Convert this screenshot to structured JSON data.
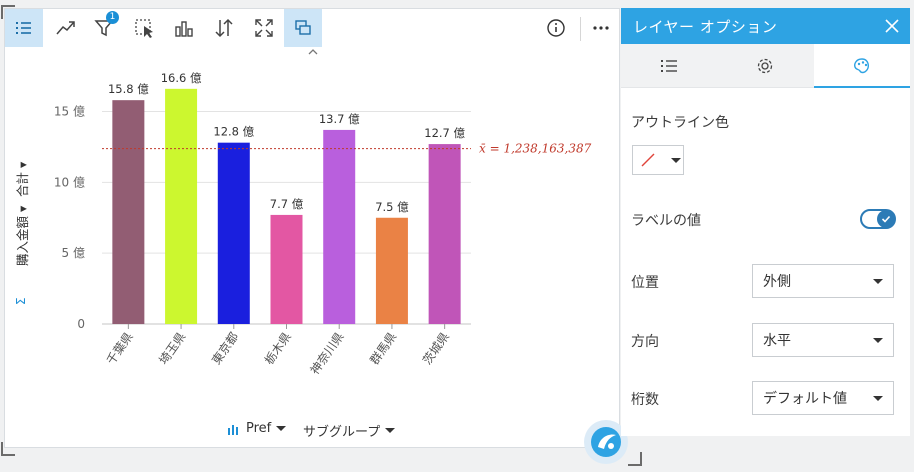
{
  "toolbar": {
    "buttons": [
      "legend",
      "trend",
      "filter",
      "select",
      "visualization-type",
      "sort",
      "maximize",
      "flip-card",
      "info",
      "more"
    ],
    "filter_badge": "1"
  },
  "colors": {
    "accent": "#2ea3e3",
    "mean_line": "#c0392b",
    "toggle_on": "#2c7bb6"
  },
  "chart": {
    "y_axis_title": "購入金額",
    "y_axis_stat": "合計",
    "mean_label": "x̄ = 1,238,163,387",
    "x_field": "Pref",
    "subgroup_label": "サブグループ"
  },
  "chart_data": {
    "type": "bar",
    "categories": [
      "千葉県",
      "埼玉県",
      "東京都",
      "栃木県",
      "神奈川県",
      "群馬県",
      "茨城県"
    ],
    "values": [
      1580000000,
      1660000000,
      1280000000,
      770000000,
      1370000000,
      750000000,
      1270000000
    ],
    "data_labels": [
      "15.8 億",
      "16.6 億",
      "12.8 億",
      "7.7 億",
      "13.7 億",
      "7.5 億",
      "12.7 億"
    ],
    "bar_colors": [
      "#925d73",
      "#ccf72f",
      "#1a1fde",
      "#e357a3",
      "#b95fdd",
      "#ea8245",
      "#c055b8"
    ],
    "ylabel": "購入金額 合計",
    "ylim": [
      0,
      1800000000
    ],
    "yticks": [
      0,
      500000000,
      1000000000,
      1500000000
    ],
    "ytick_labels": [
      "0",
      "5 億",
      "10 億",
      "15 億"
    ],
    "mean": 1238163387,
    "grid": true
  },
  "panel": {
    "title": "レイヤー オプション",
    "tabs": [
      "legend-tab",
      "settings-tab",
      "style-tab"
    ],
    "outline_color_label": "アウトライン色",
    "label_values_label": "ラベルの値",
    "label_values_on": true,
    "position_label": "位置",
    "position_value": "外側",
    "direction_label": "方向",
    "direction_value": "水平",
    "digits_label": "桁数",
    "digits_value": "デフォルト値"
  }
}
